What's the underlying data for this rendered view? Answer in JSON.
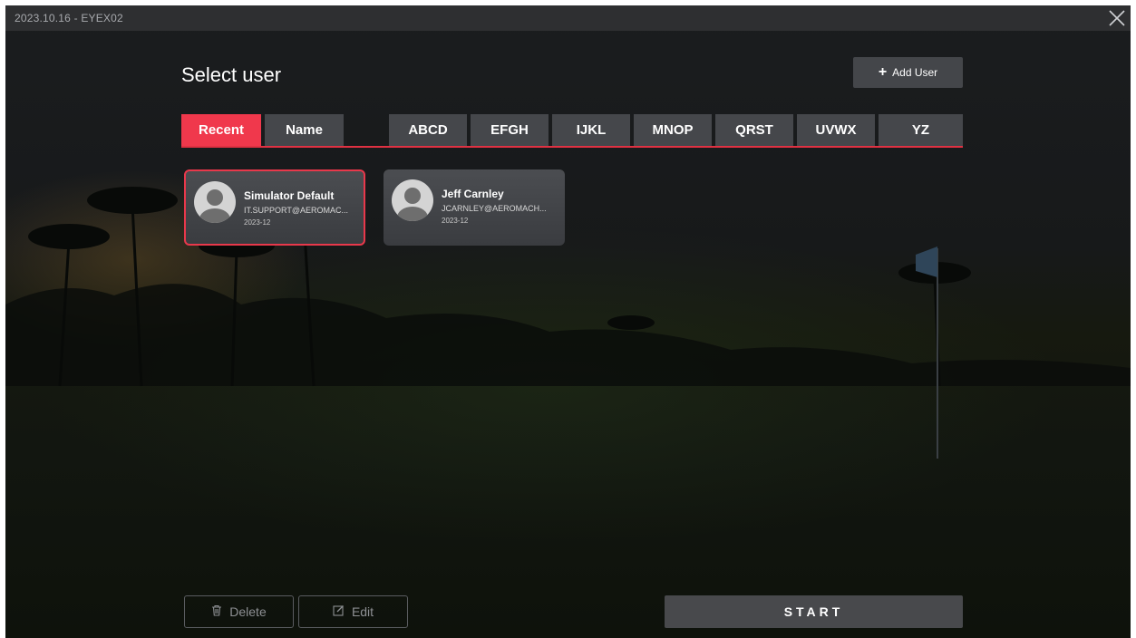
{
  "window": {
    "title": "2023.10.16 - EYEX02",
    "close_icon": "close-icon"
  },
  "header": {
    "title": "Select user",
    "add_user_label": "Add User",
    "add_user_icon": "plus-icon"
  },
  "tabs": [
    {
      "label": "Recent",
      "active": true
    },
    {
      "label": "Name",
      "active": false
    },
    {
      "label": "ABCD",
      "active": false
    },
    {
      "label": "EFGH",
      "active": false
    },
    {
      "label": "IJKL",
      "active": false
    },
    {
      "label": "MNOP",
      "active": false
    },
    {
      "label": "QRST",
      "active": false
    },
    {
      "label": "UVWX",
      "active": false
    },
    {
      "label": "YZ",
      "active": false
    }
  ],
  "users": [
    {
      "name": "Simulator Default",
      "email": "IT.SUPPORT@AEROMAC...",
      "date": "2023-12",
      "selected": true,
      "icon": "avatar-icon"
    },
    {
      "name": "Jeff Carnley",
      "email": "JCARNLEY@AEROMACH...",
      "date": "2023-12",
      "selected": false,
      "icon": "avatar-icon"
    }
  ],
  "footer": {
    "delete_label": "Delete",
    "delete_icon": "trash-icon",
    "edit_label": "Edit",
    "edit_icon": "edit-icon",
    "start_label": "START"
  },
  "colors": {
    "accent": "#f0384c",
    "tab_bg": "#45474b",
    "titlebar_bg": "#2e2f31"
  }
}
